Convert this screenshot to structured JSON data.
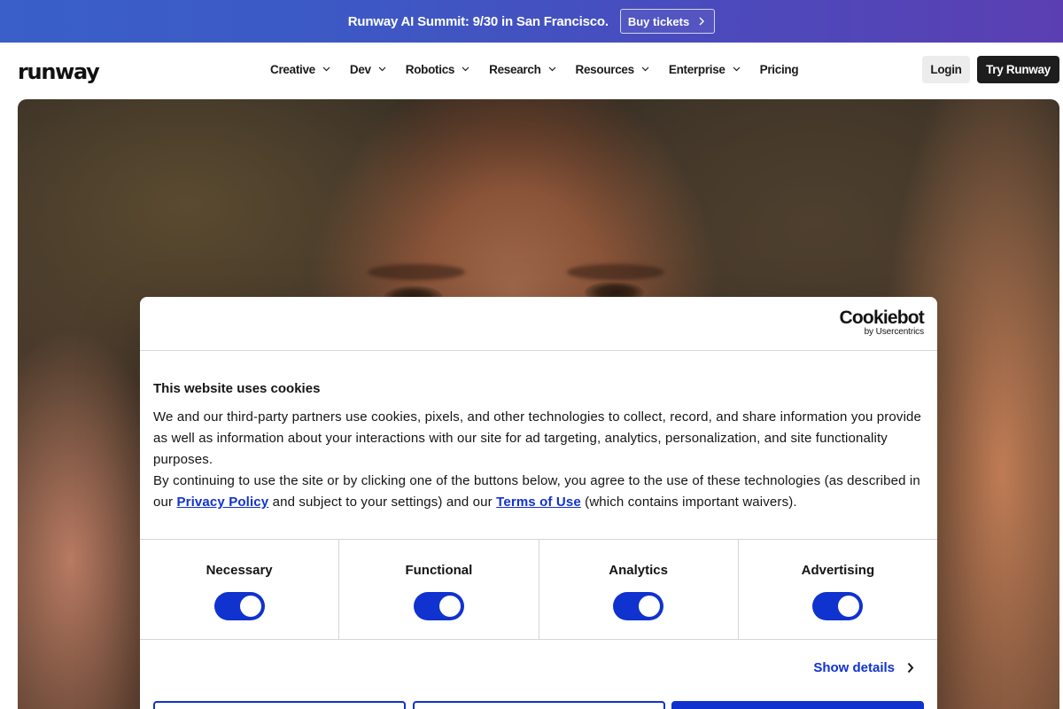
{
  "banner": {
    "text": "Runway AI Summit: 9/30 in San Francisco.",
    "button_label": "Buy tickets"
  },
  "nav": {
    "logo": "runway",
    "items": [
      {
        "label": "Creative",
        "dropdown": true
      },
      {
        "label": "Dev",
        "dropdown": true
      },
      {
        "label": "Robotics",
        "dropdown": true
      },
      {
        "label": "Research",
        "dropdown": true
      },
      {
        "label": "Resources",
        "dropdown": true
      },
      {
        "label": "Enterprise",
        "dropdown": true
      },
      {
        "label": "Pricing",
        "dropdown": false
      }
    ],
    "login_label": "Login",
    "try_label": "Try Runway"
  },
  "cookie_dialog": {
    "brand": "Cookiebot",
    "brand_sub": "by Usercentrics",
    "title": "This website uses cookies",
    "paragraph1": "We and our third-party partners use cookies, pixels, and other technologies to collect, record, and share information you provide as well as information about your interactions with our site for ad targeting, analytics, personalization, and site functionality purposes.",
    "paragraph2_start": "By continuing to use the site or by clicking one of the buttons below, you agree to the use of these technologies (as described in our ",
    "privacy_link": "Privacy Policy",
    "paragraph2_mid": " and subject to your settings) and our ",
    "terms_link": "Terms of Use",
    "paragraph2_end": " (which contains important waivers).",
    "categories": [
      {
        "label": "Necessary",
        "enabled": true
      },
      {
        "label": "Functional",
        "enabled": true
      },
      {
        "label": "Analytics",
        "enabled": true
      },
      {
        "label": "Advertising",
        "enabled": true
      }
    ],
    "show_details_label": "Show details"
  },
  "colors": {
    "accent": "#1032cf",
    "banner_start": "#3a5fc8",
    "banner_end": "#5b3fb2",
    "try_button": "#1d1d1d"
  }
}
